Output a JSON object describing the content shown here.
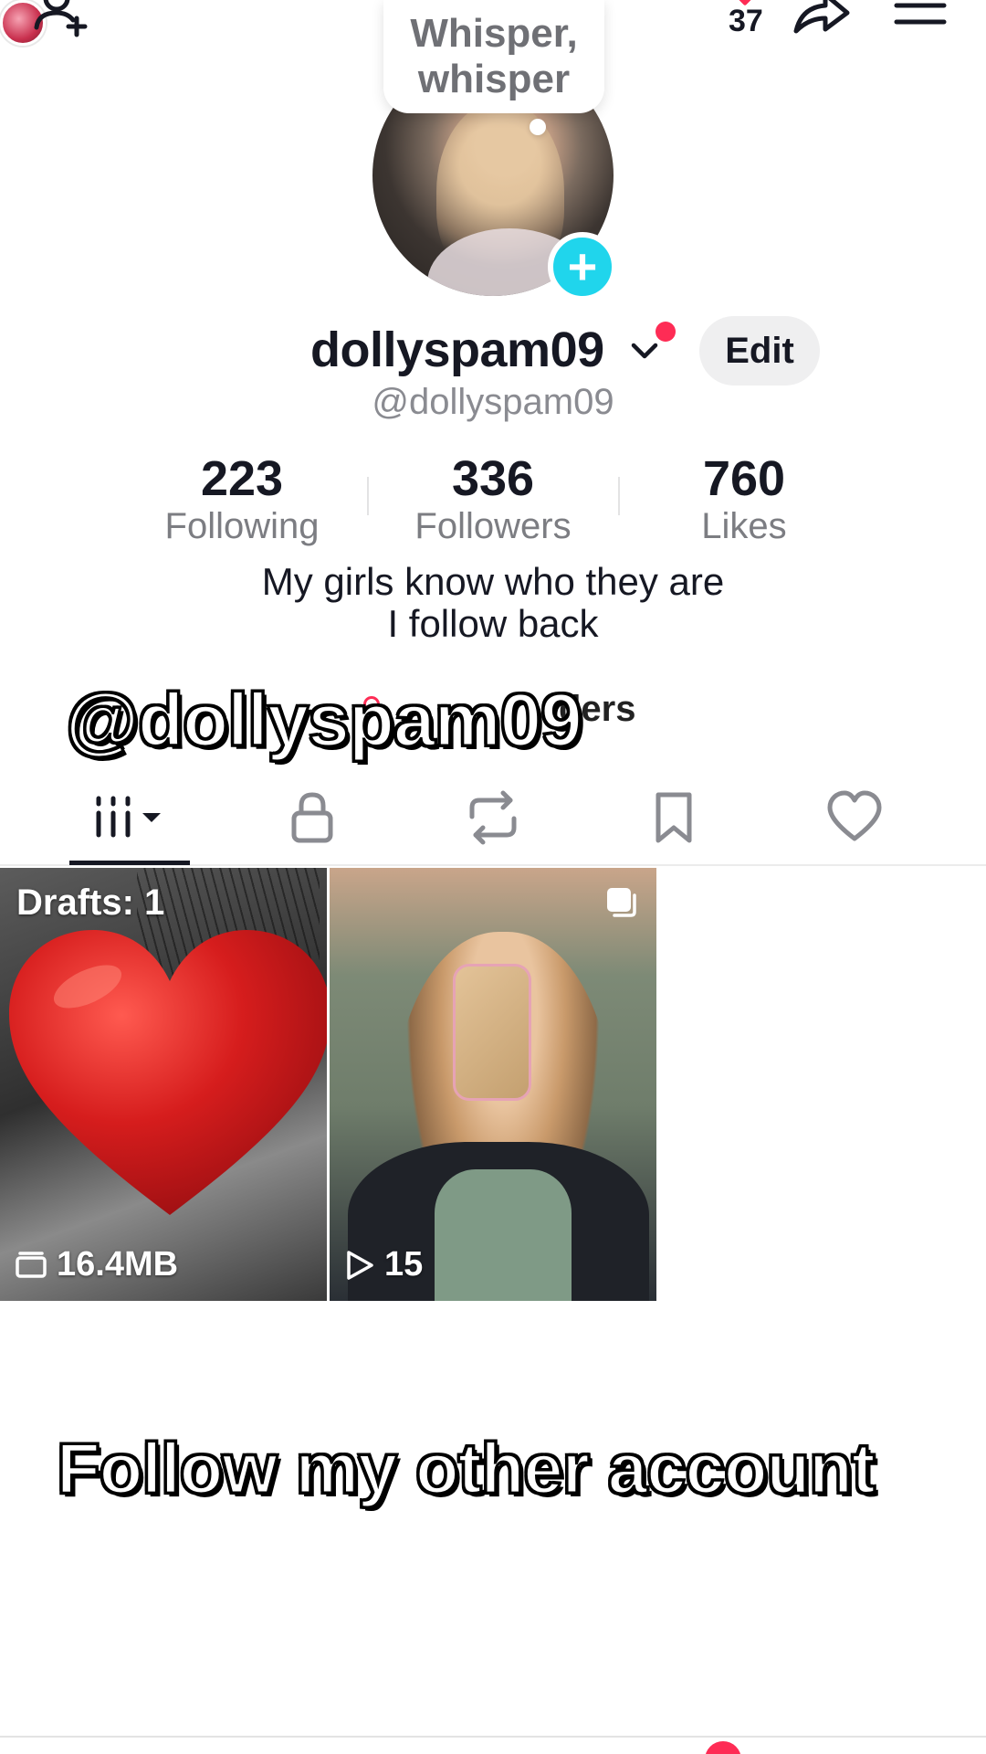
{
  "topbar": {
    "story_count": "37"
  },
  "bubble": {
    "text_line1": "Whisper,",
    "text_line2": "whisper"
  },
  "profile": {
    "username": "dollyspam09",
    "handle": "@dollyspam09",
    "edit_label": "Edit",
    "stats": [
      {
        "value": "223",
        "label": "Following"
      },
      {
        "value": "336",
        "label": "Followers"
      },
      {
        "value": "760",
        "label": "Likes"
      }
    ],
    "bio_line1": "My girls know who they are",
    "bio_line2": "I follow back",
    "link_partial": "ders"
  },
  "overlay": {
    "handle_text": "@dollyspam09",
    "follow_text": "Follow my other account"
  },
  "tabs": [
    "videos",
    "private",
    "reposts",
    "saved",
    "liked"
  ],
  "grid": [
    {
      "label": "Drafts: 1",
      "meta": "16.4MB",
      "meta_icon": "drafts-folder-icon"
    },
    {
      "label": "",
      "meta": "15",
      "meta_icon": "play-icon"
    }
  ],
  "colors": {
    "accent_red": "#fe2c55",
    "accent_cyan": "#20d5ec",
    "text_primary": "#161823",
    "text_secondary": "#7c7d82"
  }
}
